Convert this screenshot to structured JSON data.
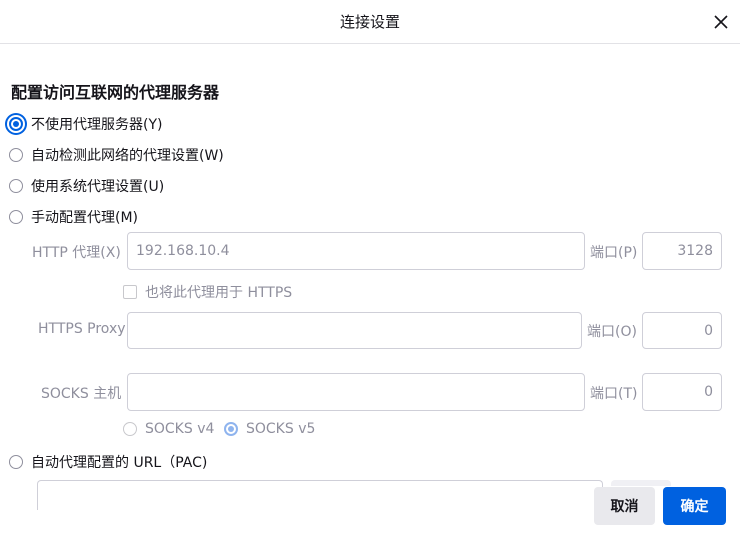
{
  "dialog": {
    "title": "连接设置",
    "close_icon": "close-icon"
  },
  "section": {
    "heading": "配置访问互联网的代理服务器"
  },
  "proxy_options": [
    {
      "label": "不使用代理服务器(Y)",
      "checked": true
    },
    {
      "label": "自动检测此网络的代理设置(W)",
      "checked": false
    },
    {
      "label": "使用系统代理设置(U)",
      "checked": false
    },
    {
      "label": "手动配置代理(M)",
      "checked": false
    },
    {
      "label": "自动代理配置的 URL（PAC)",
      "checked": false
    }
  ],
  "manual": {
    "http": {
      "label": "HTTP 代理(X)",
      "value": "192.168.10.4",
      "port_label": "端口(P)",
      "port_value": "3128"
    },
    "also_https": {
      "label": "也将此代理用于 HTTPS",
      "checked": false
    },
    "https": {
      "label": "HTTPS Proxy",
      "value": "",
      "port_label": "端口(O)",
      "port_value": "0"
    },
    "socks": {
      "label": "SOCKS 主机",
      "value": "",
      "port_label": "端口(T)",
      "port_value": "0"
    },
    "socks_versions": [
      {
        "label": "SOCKS v4",
        "checked": false
      },
      {
        "label": "SOCKS v5",
        "checked": true
      }
    ]
  },
  "buttons": {
    "cancel": "取消",
    "ok": "确定"
  },
  "colors": {
    "accent": "#0061e0",
    "text": "#15141a",
    "disabled_text": "#8f8f9d"
  }
}
